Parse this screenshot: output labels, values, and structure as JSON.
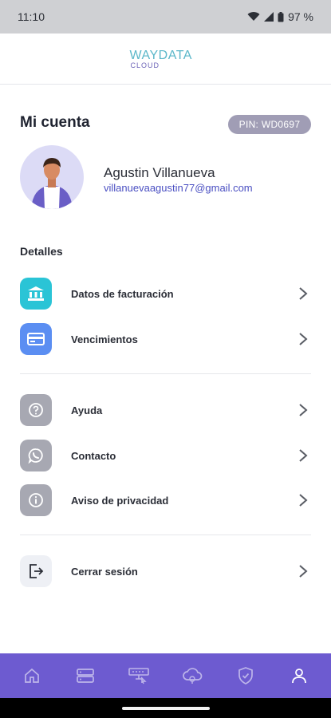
{
  "status_bar": {
    "time": "11:10",
    "battery": "97 %"
  },
  "app_bar": {
    "logo_main": "WAYDATA",
    "logo_sub": "CLOUD"
  },
  "account": {
    "title": "Mi cuenta",
    "pin": "PIN: WD0697",
    "name": "Agustin Villanueva",
    "email": "villanuevaagustin77@gmail.com"
  },
  "details": {
    "title": "Detalles",
    "items": [
      {
        "label": "Datos de facturación",
        "icon": "bank-icon",
        "color": "#2ac4d6"
      },
      {
        "label": "Vencimientos",
        "icon": "credit-card-icon",
        "color": "#5b8ef2"
      }
    ]
  },
  "support": {
    "items": [
      {
        "label": "Ayuda",
        "icon": "help-icon",
        "color": "#a7a8b2"
      },
      {
        "label": "Contacto",
        "icon": "whatsapp-icon",
        "color": "#a7a8b2"
      },
      {
        "label": "Aviso de privacidad",
        "icon": "info-icon",
        "color": "#a7a8b2"
      }
    ]
  },
  "logout": {
    "label": "Cerrar sesión",
    "icon": "logout-icon",
    "color": "#eef0f5"
  },
  "bottom_nav": {
    "items": [
      {
        "icon": "home-icon",
        "active": false
      },
      {
        "icon": "server-icon",
        "active": false
      },
      {
        "icon": "network-icon",
        "active": false
      },
      {
        "icon": "cloud-icon",
        "active": false
      },
      {
        "icon": "shield-icon",
        "active": false
      },
      {
        "icon": "profile-icon",
        "active": true
      }
    ]
  },
  "colors": {
    "nav_bg": "#6d5bd0",
    "accent": "#4a4fc2",
    "pin_bg": "#a09db5"
  }
}
